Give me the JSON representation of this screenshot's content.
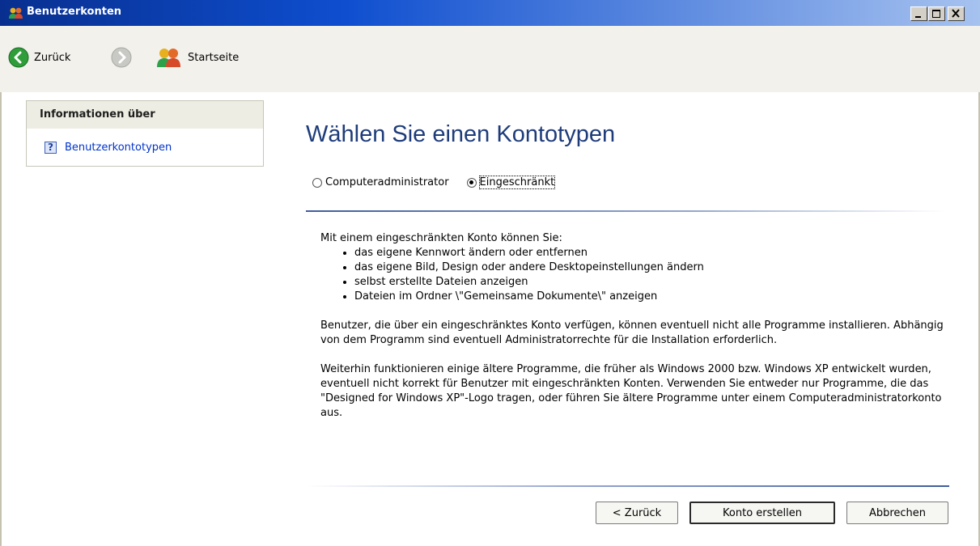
{
  "window": {
    "title": "Benutzerkonten"
  },
  "toolbar": {
    "back_label": "Zurück",
    "home_label": "Startseite"
  },
  "sidebar": {
    "heading": "Informationen über",
    "link": "Benutzerkontotypen"
  },
  "main": {
    "heading": "Wählen Sie einen Kontotypen",
    "radio_admin": "Computeradministrator",
    "radio_limited": "Eingeschränkt",
    "selected": "Eingeschränkt",
    "intro": "Mit einem eingeschränkten Konto können Sie:",
    "bullets": [
      "das eigene Kennwort ändern oder entfernen",
      "das eigene Bild, Design oder andere Desktopeinstellungen ändern",
      "selbst erstellte Dateien anzeigen",
      "Dateien im Ordner \\\"Gemeinsame Dokumente\\\" anzeigen"
    ],
    "para1": "Benutzer, die über ein eingeschränktes Konto verfügen, können eventuell nicht alle Programme installieren. Abhängig von dem Programm sind eventuell Administratorrechte für die Installation erforderlich.",
    "para2": "Weiterhin funktionieren einige ältere Programme, die früher als Windows 2000 bzw. Windows XP entwickelt wurden, eventuell nicht korrekt für Benutzer mit eingeschränkten Konten. Verwenden Sie entweder nur Programme, die das \"Designed for Windows XP\"-Logo tragen, oder führen Sie ältere Programme unter einem Computeradministratorkonto aus."
  },
  "buttons": {
    "back": "< Zurück",
    "create": "Konto erstellen",
    "cancel": "Abbrechen"
  },
  "colors": {
    "title_bar_start": "#082f8f",
    "heading": "#1e3c7a",
    "link": "#0033cc",
    "panel_head": "#eeede3"
  }
}
